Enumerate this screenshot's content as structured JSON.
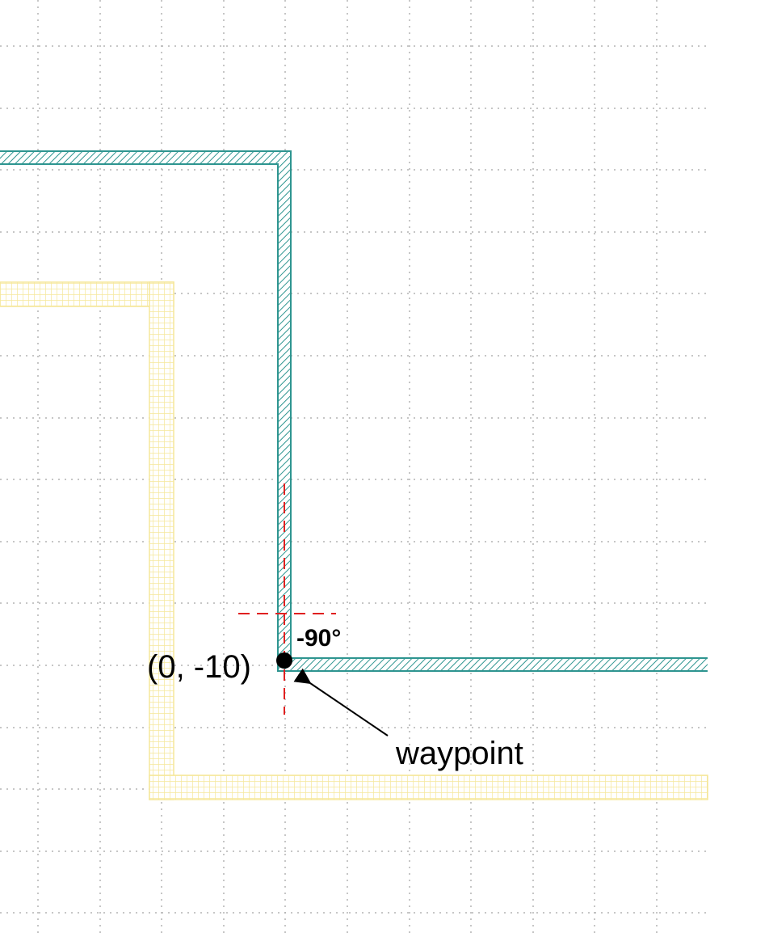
{
  "diagram": {
    "labels": {
      "coordinate": "(0, -10)",
      "angle": "-90°",
      "waypoint": "waypoint"
    },
    "colors": {
      "grid": "#b4b4b4",
      "teal_path": "#2e9590",
      "yellow_path": "#f5e79a",
      "guide": "#e02020",
      "marker": "#000000"
    }
  }
}
